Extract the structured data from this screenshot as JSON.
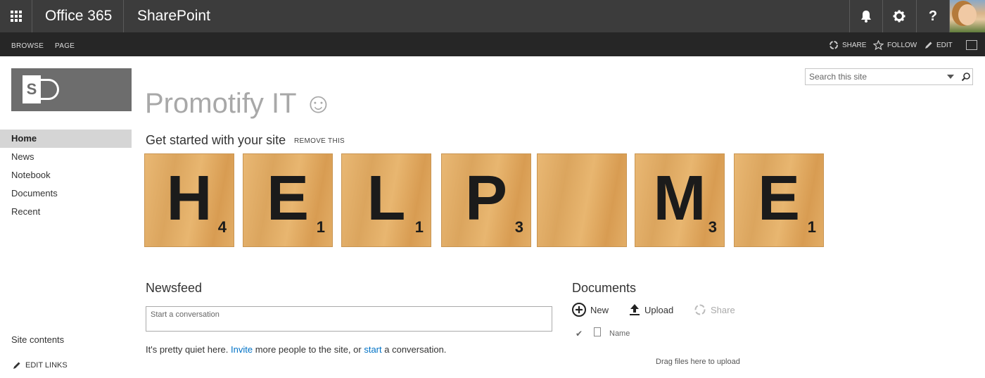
{
  "suite_bar": {
    "brand": "Office 365",
    "app_name": "SharePoint",
    "help_label": "?",
    "colors": {
      "background": "#3c3c3c",
      "text": "#ffffff"
    }
  },
  "ribbon": {
    "tabs": [
      "BROWSE",
      "PAGE"
    ],
    "actions": {
      "share": "SHARE",
      "follow": "FOLLOW",
      "edit": "EDIT"
    }
  },
  "logo": {
    "letter": "S"
  },
  "nav": {
    "items": [
      {
        "label": "Home",
        "active": true
      },
      {
        "label": "News",
        "active": false
      },
      {
        "label": "Notebook",
        "active": false
      },
      {
        "label": "Documents",
        "active": false
      },
      {
        "label": "Recent",
        "active": false
      }
    ],
    "site_contents": "Site contents",
    "edit_links": "EDIT LINKS"
  },
  "search": {
    "placeholder": "Search this site"
  },
  "site": {
    "title": "Promotify IT ☺"
  },
  "get_started": {
    "title": "Get started with your site",
    "remove_label": "REMOVE THIS",
    "tiles": [
      {
        "letter": "H",
        "score": "4"
      },
      {
        "letter": "E",
        "score": "1"
      },
      {
        "letter": "L",
        "score": "1"
      },
      {
        "letter": "P",
        "score": "3"
      },
      {
        "letter": "",
        "score": ""
      },
      {
        "letter": "M",
        "score": "3"
      },
      {
        "letter": "E",
        "score": "1"
      }
    ]
  },
  "newsfeed": {
    "title": "Newsfeed",
    "placeholder": "Start a conversation",
    "quiet_pre": "It's pretty quiet here. ",
    "invite_link": "Invite",
    "quiet_mid": " more people to the site, or ",
    "start_link": "start",
    "quiet_post": " a conversation."
  },
  "documents": {
    "title": "Documents",
    "commands": {
      "new": "New",
      "upload": "Upload",
      "share": "Share"
    },
    "columns": {
      "name": "Name"
    },
    "drag_hint": "Drag files here to upload"
  }
}
